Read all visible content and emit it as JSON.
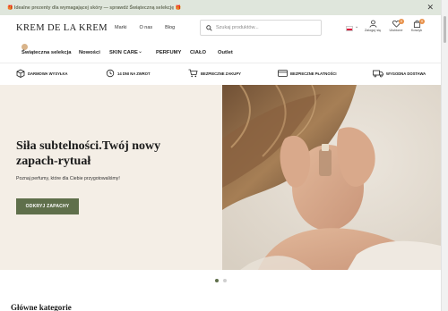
{
  "promo": {
    "text": "🎁 Idealne prezenty dla wymagającej skóry — sprawdź Świąteczną selekcję 🎁",
    "close": "✕"
  },
  "header": {
    "logo": "KREM DE LA KREM",
    "nav": [
      "Marki",
      "O nas",
      "Blog"
    ],
    "search_placeholder": "Szukaj produktów...",
    "account_label": "Zaloguj się",
    "wishlist_label": "Ulubione",
    "wishlist_count": "0",
    "cart_label": "Koszyk",
    "cart_count": "0"
  },
  "main_nav": {
    "items": [
      "Świąteczna selekcja",
      "Nowości",
      "SKIN CARE",
      "PERFUMY",
      "CIAŁO",
      "Outlet"
    ],
    "dropdown_caret": "⌄"
  },
  "benefits": [
    "DARMOWA WYSYŁKA",
    "14 DNI NA ZWROT",
    "BEZPIECZNE ZAKUPY",
    "BEZPIECZNE PŁATNOŚCI",
    "WYGODNA DOSTAWA"
  ],
  "hero": {
    "title": "Siła subtelności.Twój nowy zapach-rytuał",
    "subtitle": "Poznaj perfumy, które dla Ciebie przygotowaliśmy!",
    "cta": "ODKRYJ ZAPACHY",
    "slides_total": 2,
    "slide_active": 1
  },
  "section": {
    "title": "Główne kategorie"
  },
  "colors": {
    "accent": "#5f6f4b",
    "promo_bg": "#dfe6dc",
    "hero_bg": "#f4eee6",
    "badge": "#e8914a"
  },
  "icons": [
    "search-icon",
    "user-icon",
    "heart-icon",
    "bag-icon",
    "box-icon",
    "return-icon",
    "cart-icon",
    "card-icon",
    "truck-icon",
    "close-icon"
  ]
}
